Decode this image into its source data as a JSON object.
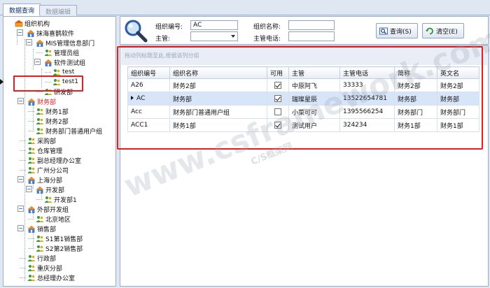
{
  "tabs": [
    "数据查询",
    "数据编辑"
  ],
  "tree": {
    "root": "组织机构",
    "nodes": [
      "抹海喜鹊软件",
      "MIS管理信息部门",
      "管理员组",
      "软件测试组",
      "test",
      "test1",
      "研发部",
      "财务部",
      "财务1部",
      "财务2部",
      "财务部门普通用户组",
      "采购部",
      "仓库管理",
      "副总经理办公室",
      "广州分公司",
      "上海分部",
      "开发部",
      "开发部1",
      "外部开发组",
      "北京地区",
      "销售部",
      "S1第1销售部",
      "S2第2销售部",
      "行政部",
      "重庆分部",
      "总经理办公室"
    ]
  },
  "search": {
    "code_label": "组织编号:",
    "code_value": "AC",
    "name_label": "组织名称:",
    "name_value": "",
    "manager_label": "主管:",
    "manager_value": "",
    "phone_label": "主管电话:",
    "phone_value": "",
    "query_button": "查询(S)",
    "clear_button": "清空(E)"
  },
  "grid": {
    "group_hint": "拖动列标题至此,根据该列分组",
    "columns": [
      "组织编号",
      "组织名称",
      "可用",
      "主管",
      "主管电话",
      "简称",
      "英文名"
    ],
    "rows": [
      {
        "code": "A26",
        "name": "财务2部",
        "enabled": true,
        "manager": "中原阿飞",
        "phone": "33333",
        "short": "财务2部",
        "english": "财务2部"
      },
      {
        "code": "AC",
        "name": "财务部",
        "enabled": true,
        "manager": "瑞璨星辰",
        "phone": "13522654781",
        "short": "财务部",
        "english": "财务部"
      },
      {
        "code": "Acc",
        "name": "财务部门普通用户组",
        "enabled": false,
        "manager": "小菜可可",
        "phone": "1395566254",
        "short": "财务部门",
        "english": "财务部门"
      },
      {
        "code": "ACC1",
        "name": "财务1部",
        "enabled": true,
        "manager": "测试用户",
        "phone": "324234",
        "short": "财务1部",
        "english": "财务1部"
      }
    ]
  },
  "watermark": {
    "main": "www.csframework.com",
    "sub": "C/S框架网"
  }
}
